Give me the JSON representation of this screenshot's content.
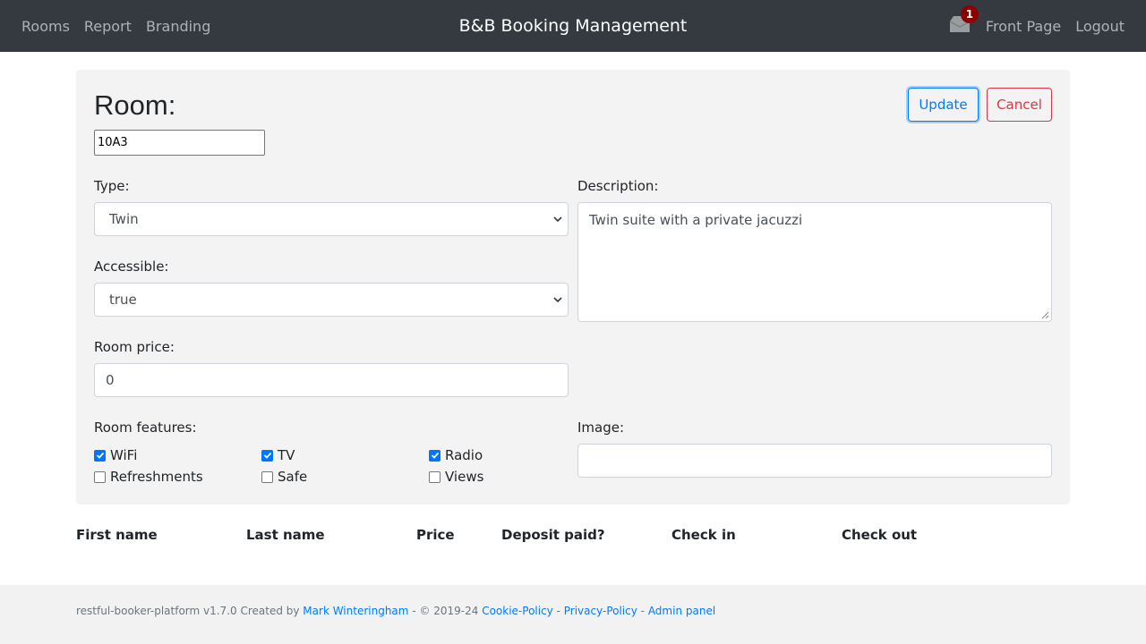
{
  "navbar": {
    "links_left": [
      "Rooms",
      "Report",
      "Branding"
    ],
    "brand": "B&B Booking Management",
    "inbox_badge": "1",
    "front_page": "Front Page",
    "logout": "Logout",
    "bg_color": "#343a40",
    "badge_color": "#8b0000"
  },
  "room": {
    "title": "Room:",
    "name_value": "10A3",
    "update_label": "Update",
    "cancel_label": "Cancel",
    "type_label": "Type:",
    "type_value": "Twin",
    "accessible_label": "Accessible:",
    "accessible_value": "true",
    "price_label": "Room price:",
    "price_value": "0",
    "description_label": "Description:",
    "description_value": "Twin suite with a private jacuzzi",
    "features_label": "Room features:",
    "features": [
      {
        "label": "WiFi",
        "checked": true
      },
      {
        "label": "TV",
        "checked": true
      },
      {
        "label": "Radio",
        "checked": true
      },
      {
        "label": "Refreshments",
        "checked": false
      },
      {
        "label": "Safe",
        "checked": false
      },
      {
        "label": "Views",
        "checked": false
      }
    ],
    "image_label": "Image:",
    "image_value": ""
  },
  "bookings": {
    "headers": [
      "First name",
      "Last name",
      "Price",
      "Deposit paid?",
      "Check in",
      "Check out"
    ]
  },
  "footer": {
    "prefix": "restful-booker-platform v1.7.0 Created by ",
    "author": "Mark Winteringham",
    "copyright": " - © 2019-24 ",
    "cookie": "Cookie-Policy",
    "sep1": " - ",
    "privacy": "Privacy-Policy",
    "sep2": " - ",
    "admin": "Admin panel"
  },
  "icons": {
    "inbox": "envelope-icon",
    "dropdown": "chevron-down-icon",
    "checkbox": "check-icon"
  },
  "colors": {
    "primary": "#007bff",
    "danger": "#dc3545",
    "checkbox": "#0075ff"
  }
}
